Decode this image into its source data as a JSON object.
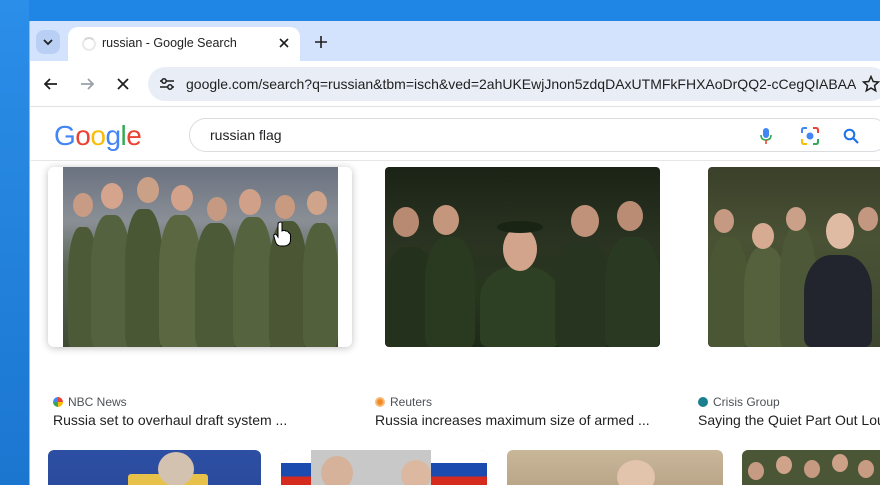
{
  "browser": {
    "tab_title": "russian - Google Search",
    "url": "google.com/search?q=russian&tbm=isch&ved=2ahUKEwjJnon5zdqDAxUTMFkFHXAoDrQQ2-cCegQIABAA..."
  },
  "google": {
    "logo_letters": [
      "G",
      "o",
      "o",
      "g",
      "l",
      "e"
    ],
    "logo_colors": [
      "#4285f4",
      "#ea4335",
      "#fbbc05",
      "#4285f4",
      "#34a853",
      "#ea4335"
    ],
    "query": "russian flag"
  },
  "results": [
    {
      "source": "NBC News",
      "caption": "Russia set to overhaul draft system ...",
      "source_color": "#7b3fbf"
    },
    {
      "source": "Reuters",
      "caption": "Russia increases maximum size of armed ...",
      "source_color": "#f08a24"
    },
    {
      "source": "Crisis Group",
      "caption": "Saying the Quiet Part Out Lou",
      "source_color": "#1a7f8e"
    }
  ],
  "colors": {
    "tabstrip": "#d3e3fd",
    "omnibox": "#e9eef6",
    "accent": "#1a73e8"
  }
}
